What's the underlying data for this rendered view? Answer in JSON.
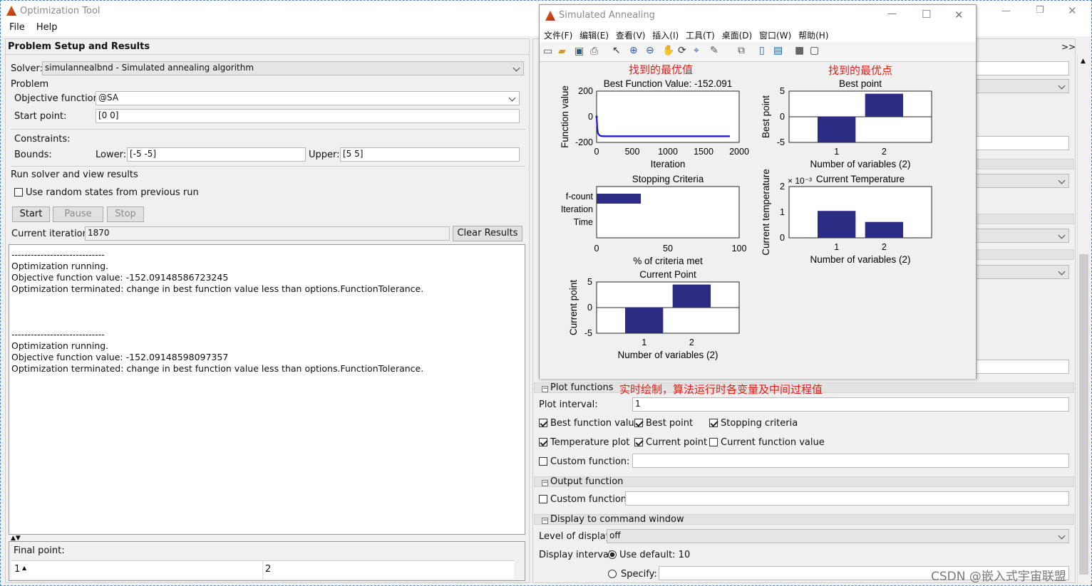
{
  "app": {
    "title": "Optimization Tool",
    "menu": [
      "File",
      "Help"
    ],
    "panel_title": "Problem Setup and Results",
    "expand_label": ">>"
  },
  "solver": {
    "label": "Solver:",
    "value": "simulannealbnd - Simulated annealing algorithm"
  },
  "problem": {
    "title": "Problem",
    "objective_label": "Objective function:",
    "objective_value": "@SA",
    "start_label": "Start point:",
    "start_value": "[0 0]"
  },
  "constraints": {
    "title": "Constraints:",
    "bounds_label": "Bounds:",
    "lower_label": "Lower:",
    "lower_value": "[-5 -5]",
    "upper_label": "Upper:",
    "upper_value": "[5 5]"
  },
  "run": {
    "title": "Run solver and view results",
    "random_label": "Use random states from previous run",
    "start": "Start",
    "pause": "Pause",
    "stop": "Stop",
    "iter_label": "Current iteration:",
    "iter_value": "1870",
    "clear": "Clear Results"
  },
  "log": [
    "-----------------------------",
    "Optimization running.",
    "Objective function value: -152.09148586723245",
    "Optimization terminated: change in best function value less than options.FunctionTolerance.",
    "",
    "",
    "",
    "-----------------------------",
    "Optimization running.",
    "Objective function value: -152.09148598097357",
    "Optimization terminated: change in best function value less than options.FunctionTolerance."
  ],
  "final": {
    "label": "Final point:",
    "col1": "1",
    "col2": "2"
  },
  "figure": {
    "title": "Simulated Annealing",
    "menu": [
      "文件(F)",
      "编辑(E)",
      "查看(V)",
      "插入(I)",
      "工具(T)",
      "桌面(D)",
      "窗口(W)",
      "帮助(H)"
    ]
  },
  "annotations": {
    "best_value": "找到的最优值",
    "best_point": "找到的最优点",
    "plot_note": "实时绘制，算法运行时各变量及中间过程值"
  },
  "options": {
    "plot_title": "Plot functions",
    "plot_interval_label": "Plot interval:",
    "plot_interval_value": "1",
    "checks": [
      {
        "label": "Best function value",
        "checked": true
      },
      {
        "label": "Best point",
        "checked": true
      },
      {
        "label": "Stopping criteria",
        "checked": true
      },
      {
        "label": "Temperature plot",
        "checked": true
      },
      {
        "label": "Current point",
        "checked": true
      },
      {
        "label": "Current function value",
        "checked": false
      }
    ],
    "custom_label": "Custom function:",
    "output_title": "Output function",
    "output_custom_label": "Custom function:",
    "display_title": "Display to command window",
    "level_label": "Level of display:",
    "level_value": "off",
    "interval_label": "Display interval:",
    "use_default": "Use default: 10",
    "specify": "Specify:"
  },
  "watermark": "CSDN @嵌入式宇宙联盟",
  "chart_data": [
    {
      "type": "line",
      "title": "Best Function Value: -152.091",
      "xlabel": "Iteration",
      "ylabel": "Function value",
      "xlim": [
        0,
        2000
      ],
      "ylim": [
        -200,
        200
      ],
      "xticks": [
        "0",
        "500",
        "1000",
        "1500",
        "2000"
      ],
      "yticks": [
        "200",
        "0",
        "-200"
      ],
      "x": [
        0,
        10,
        20,
        40,
        60,
        100,
        200,
        500,
        1000,
        1500,
        1870
      ],
      "y": [
        0,
        -95,
        -130,
        -145,
        -150,
        -152,
        -152,
        -152.09,
        -152.09,
        -152.09,
        -152.091
      ]
    },
    {
      "type": "bar",
      "title": "Best point",
      "xlabel": "Number of variables (2)",
      "ylabel": "Best point",
      "categories": [
        "1",
        "2"
      ],
      "values": [
        -5,
        4.5
      ],
      "ylim": [
        -5,
        5
      ],
      "yticks": [
        "5",
        "0",
        "-5"
      ]
    },
    {
      "type": "bar",
      "orientation": "horizontal",
      "title": "Stopping Criteria",
      "xlabel": "% of criteria met",
      "categories": [
        "f-count",
        "Iteration",
        "Time"
      ],
      "values": [
        31,
        0,
        0
      ],
      "xlim": [
        0,
        100
      ],
      "xticks": [
        "0",
        "50",
        "100"
      ]
    },
    {
      "type": "bar",
      "title": "Current Temperature",
      "xlabel": "Number of variables (2)",
      "ylabel": "Current temperature",
      "exponent": "× 10⁻³",
      "categories": [
        "1",
        "2"
      ],
      "values": [
        1.05,
        0.62
      ],
      "ylim": [
        0,
        2
      ],
      "yticks": [
        "2",
        "1",
        "0"
      ]
    },
    {
      "type": "bar",
      "title": "Current Point",
      "xlabel": "Number of variables (2)",
      "ylabel": "Current point",
      "categories": [
        "1",
        "2"
      ],
      "values": [
        -5,
        4.5
      ],
      "ylim": [
        -5,
        5
      ],
      "yticks": [
        "5",
        "0",
        "-5"
      ]
    }
  ]
}
